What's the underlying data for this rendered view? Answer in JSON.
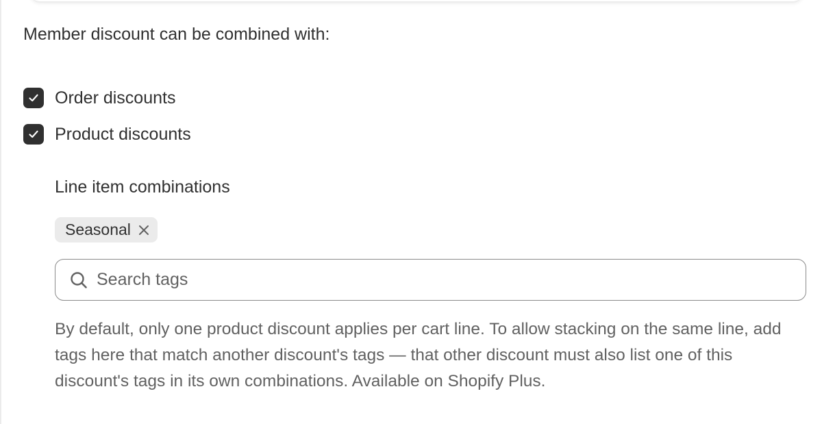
{
  "heading": "Member discount can be combined with:",
  "combinations": [
    {
      "label": "Order discounts",
      "checked": true
    },
    {
      "label": "Product discounts",
      "checked": true
    }
  ],
  "line_item": {
    "title": "Line item combinations",
    "tags": [
      {
        "label": "Seasonal"
      }
    ],
    "search": {
      "placeholder": "Search tags",
      "value": ""
    },
    "help_text": "By default, only one product discount applies per cart line. To allow stacking on the same line, add tags here that match another discount's tags — that other discount must also list one of this discount's tags in its own combinations. Available on Shopify Plus."
  },
  "colors": {
    "checkbox_fill": "#303030",
    "text": "#303030",
    "muted_text": "#616161",
    "tag_background": "#ebebeb",
    "input_border": "#8a8a8a"
  },
  "icons": {
    "checkbox": "check-icon",
    "tag_remove": "close-icon",
    "search": "search-icon"
  }
}
